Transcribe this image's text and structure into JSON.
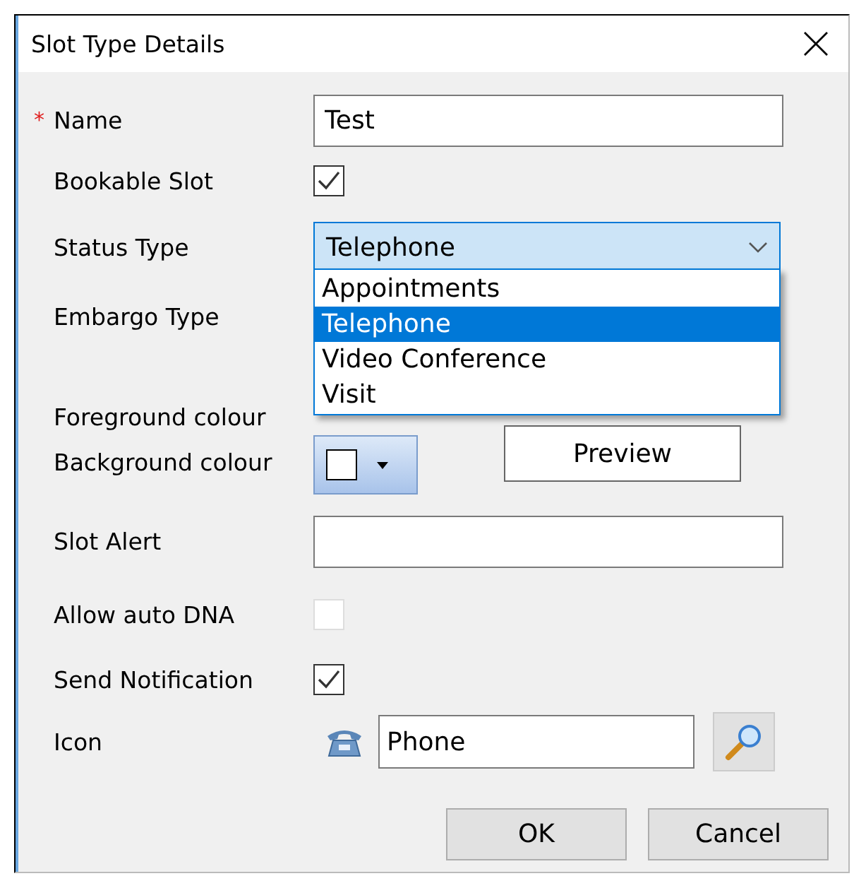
{
  "window": {
    "title": "Slot Type Details"
  },
  "fields": [
    {
      "kind": "text",
      "label": "Name",
      "required_mark": "*",
      "value": "Test"
    },
    {
      "kind": "checkbox",
      "label": "Bookable Slot",
      "checked": true,
      "disabled": false
    },
    {
      "kind": "combo",
      "label": "Status Type",
      "value": "Telephone",
      "expanded": true,
      "options": [
        {
          "label": "Appointments",
          "selected": false
        },
        {
          "label": "Telephone",
          "selected": true
        },
        {
          "label": "Video Conference",
          "selected": false
        },
        {
          "label": "Visit",
          "selected": false
        }
      ]
    },
    {
      "kind": "label",
      "label": "Embargo Type"
    },
    {
      "kind": "preview",
      "label": "Foreground colour",
      "button": "Preview"
    },
    {
      "kind": "colour",
      "label": "Background colour"
    },
    {
      "kind": "text",
      "label": "Slot Alert"
    },
    {
      "kind": "checkbox",
      "label": "Allow auto DNA",
      "checked": false,
      "disabled": true
    },
    {
      "kind": "checkbox",
      "label": "Send Notification",
      "checked": true,
      "disabled": false
    },
    {
      "kind": "icon",
      "label": "Icon",
      "value": "Phone"
    }
  ],
  "buttons": [
    "OK",
    "Cancel"
  ]
}
